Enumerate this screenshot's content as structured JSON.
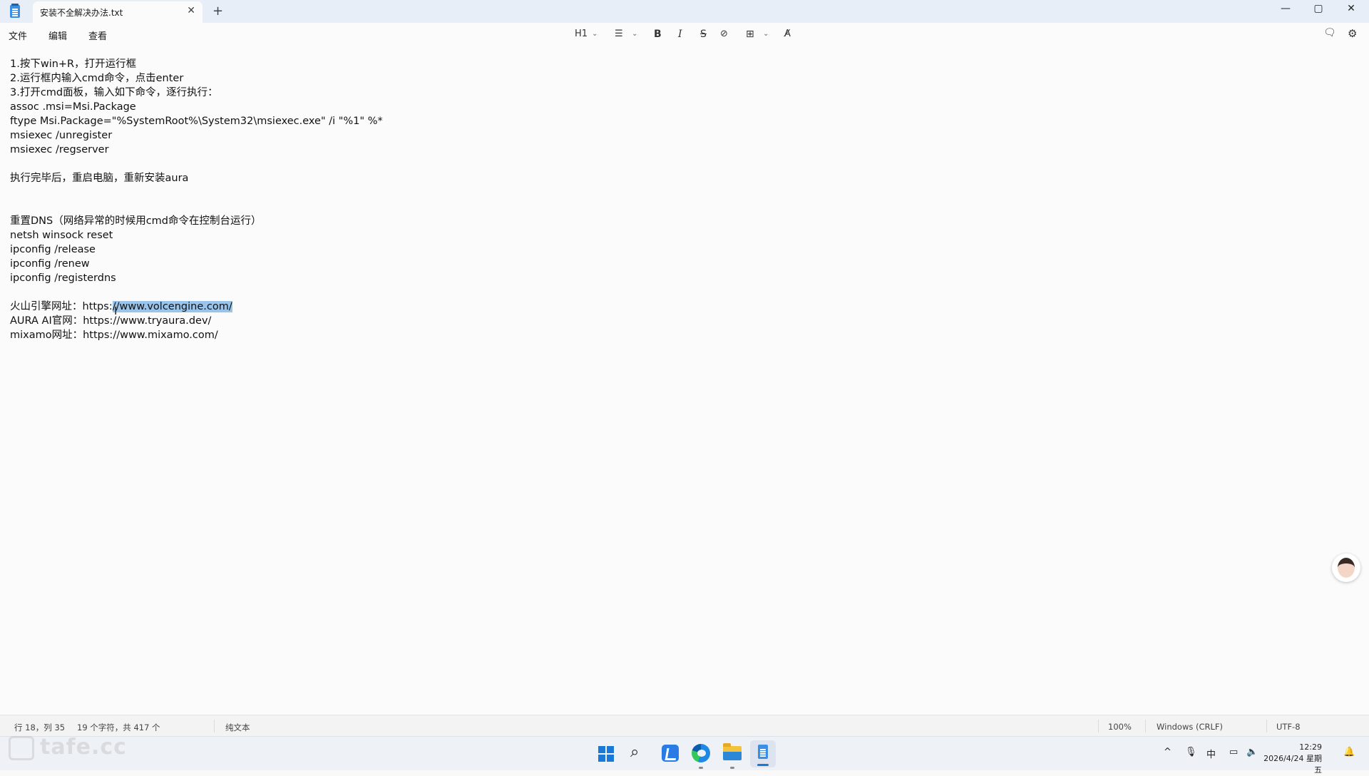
{
  "titlebar": {
    "tab_title": "安装不全解决办法.txt",
    "tab_close": "✕",
    "new_tab": "+",
    "minimize": "—",
    "maximize": "▢",
    "close": "✕"
  },
  "menu": {
    "file": "文件",
    "edit": "编辑",
    "view": "查看"
  },
  "toolbar": {
    "heading": "H1",
    "chevron": "⌄",
    "list": "☰",
    "bold": "B",
    "italic": "I",
    "strike": "S",
    "link": "⊘",
    "table": "⊞",
    "clear_format": "A̸",
    "copilot": "🗨",
    "settings": "⚙"
  },
  "editor": {
    "lines": [
      "1.按下win+R，打开运行框",
      "2.运行框内输入cmd命令，点击enter",
      "3.打开cmd面板，输入如下命令，逐行执行：",
      "assoc .msi=Msi.Package",
      "ftype Msi.Package=\"%SystemRoot%\\System32\\msiexec.exe\" /i \"%1\" %*",
      "msiexec /unregister",
      "msiexec /regserver",
      "",
      "执行完毕后，重启电脑，重新安装aura",
      "",
      "",
      "重置DNS（网络异常的时候用cmd命令在控制台运行）",
      "netsh winsock reset",
      "ipconfig /release",
      "ipconfig /renew",
      "ipconfig /registerdns",
      "",
      "火山引擎网址：https:",
      "AURA AI官网：https://www.tryaura.dev/",
      "mixamo网址：https://www.mixamo.com/"
    ],
    "selected_text": "//www.volcengine.com/",
    "cursor_glyph": "I"
  },
  "statusbar": {
    "position": "行 18，列 35",
    "chars": "19 个字符，共 417 个",
    "mode": "纯文本",
    "zoom": "100%",
    "line_ending": "Windows (CRLF)",
    "encoding": "UTF-8"
  },
  "watermark": "tafe.cc",
  "taskbar": {
    "search_glyph": "⌕",
    "tray_up": "^",
    "tray_mic": "🎙",
    "tray_ime": "中",
    "tray_net": "▭",
    "tray_vol": "🔈",
    "time": "12:29",
    "date": "2026/4/24 星期五",
    "bell": "🔔"
  },
  "colors": {
    "selection": "#99c5ec",
    "accent": "#1a78d6"
  }
}
